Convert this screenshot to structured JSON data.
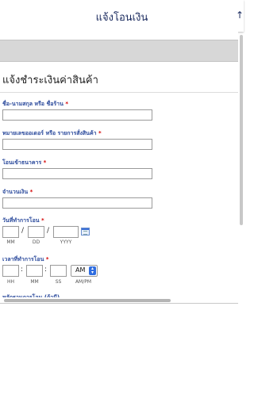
{
  "header": {
    "title": "แจ้งโอนเงิน",
    "right_icon": "arrow-icon"
  },
  "form": {
    "heading": "แจ้งชำระเงินค่าสินค้า",
    "required_mark": "*",
    "name": {
      "label": "ชื่อ-นามสกุล หรือ ชื่อร้าน",
      "value": ""
    },
    "order": {
      "label": "หมายเลขออเดอร์ หรือ รายการสั่งสินค้า",
      "value": ""
    },
    "bank": {
      "label": "โอนเข้าธนาคาร",
      "value": ""
    },
    "amount": {
      "label": "จำนวนเงิน",
      "value": ""
    },
    "date": {
      "label": "วันที่ทำการโอน",
      "separator": "/",
      "captions": [
        "MM",
        "DD",
        "YYYY"
      ],
      "icon": "calendar-icon"
    },
    "time": {
      "label": "เวลาที่ทำการโอน",
      "separator": ":",
      "captions": [
        "HH",
        "MM",
        "SS",
        "AM/PM"
      ],
      "ampm": "AM"
    },
    "cutoff_label": "หลักฐานการโอน (ถ้ามี)"
  },
  "colors": {
    "label": "#2b4a9c",
    "required": "#d40000",
    "title": "#1a2a5e",
    "select_accent": "#2f6de0"
  }
}
